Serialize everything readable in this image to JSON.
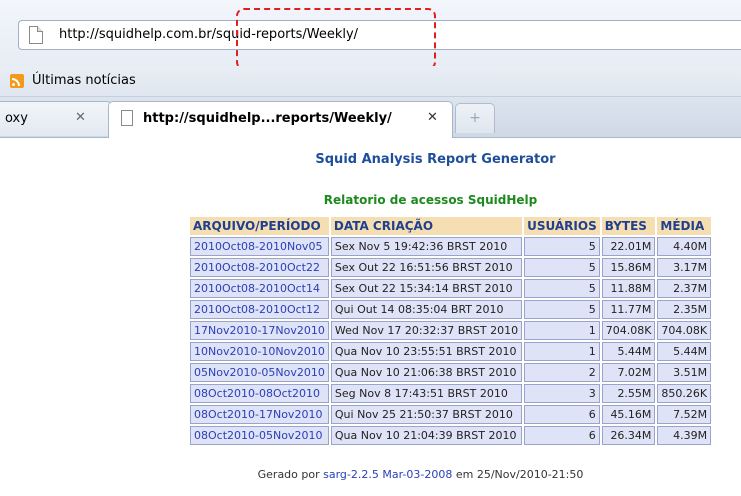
{
  "address_bar": {
    "url": "http://squidhelp.com.br/squid-reports/Weekly/"
  },
  "bookmarks": {
    "items": [
      {
        "label": "Últimas notícias",
        "icon": "rss-icon"
      }
    ]
  },
  "tabs": [
    {
      "label": "oxy"
    },
    {
      "label": "http://squidhelp...reports/Weekly/",
      "active": true
    }
  ],
  "report": {
    "title": "Squid Analysis Report Generator",
    "subtitle": "Relatorio de acessos SquidHelp",
    "columns": [
      "ARQUIVO/PERÍODO",
      "DATA CRIAÇÃO",
      "USUÁRIOS",
      "BYTES",
      "MÉDIA"
    ],
    "rows": [
      [
        "2010Oct08-2010Nov05",
        "Sex Nov 5 19:42:36 BRST 2010",
        "5",
        "22.01M",
        "4.40M"
      ],
      [
        "2010Oct08-2010Oct22",
        "Sex Out 22 16:51:56 BRST 2010",
        "5",
        "15.86M",
        "3.17M"
      ],
      [
        "2010Oct08-2010Oct14",
        "Sex Out 22 15:34:14 BRST 2010",
        "5",
        "11.88M",
        "2.37M"
      ],
      [
        "2010Oct08-2010Oct12",
        "Qui Out 14 08:35:04 BRT 2010",
        "5",
        "11.77M",
        "2.35M"
      ],
      [
        "17Nov2010-17Nov2010",
        "Wed Nov 17 20:32:37 BRST 2010",
        "1",
        "704.08K",
        "704.08K"
      ],
      [
        "10Nov2010-10Nov2010",
        "Qua Nov 10 23:55:51 BRST 2010",
        "1",
        "5.44M",
        "5.44M"
      ],
      [
        "05Nov2010-05Nov2010",
        "Qua Nov 10 21:06:38 BRST 2010",
        "2",
        "7.02M",
        "3.51M"
      ],
      [
        "08Oct2010-08Oct2010",
        "Seg Nov 8 17:43:51 BRST 2010",
        "3",
        "2.55M",
        "850.26K"
      ],
      [
        "08Oct2010-17Nov2010",
        "Qui Nov 25 21:50:37 BRST 2010",
        "6",
        "45.16M",
        "7.52M"
      ],
      [
        "08Oct2010-05Nov2010",
        "Qua Nov 10 21:04:39 BRST 2010",
        "6",
        "26.34M",
        "4.39M"
      ]
    ]
  },
  "footer": {
    "prefix": "Gerado por",
    "link": "sarg-2.2.5 Mar-03-2008",
    "suffix": "em 25/Nov/2010-21:50"
  },
  "colors": {
    "title": "#1f4e9a",
    "subtitle": "#1d8a1d",
    "header_bg": "#f5deb2",
    "cell_bg": "#dfe3f7",
    "link": "#2a3fb8",
    "highlight": "#e02020"
  }
}
